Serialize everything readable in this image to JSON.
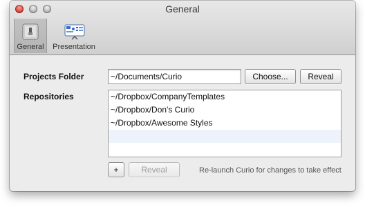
{
  "window": {
    "title": "General"
  },
  "toolbar": {
    "items": [
      {
        "label": "General",
        "icon": "general-switch-icon",
        "selected": true
      },
      {
        "label": "Presentation",
        "icon": "presentation-icon",
        "selected": false
      }
    ]
  },
  "projects_folder": {
    "label": "Projects Folder",
    "value": "~/Documents/Curio",
    "choose_button": "Choose...",
    "reveal_button": "Reveal"
  },
  "repositories": {
    "label": "Repositories",
    "items": [
      "~/Dropbox/CompanyTemplates",
      "~/Dropbox/Don's Curio",
      "~/Dropbox/Awesome Styles"
    ],
    "add_button": "+",
    "reveal_button": "Reveal",
    "hint": "Re-launch Curio for changes to take effect"
  },
  "colors": {
    "close": "#d1362c",
    "window_bg": "#ececec",
    "row_alt": "#eef3fb"
  }
}
